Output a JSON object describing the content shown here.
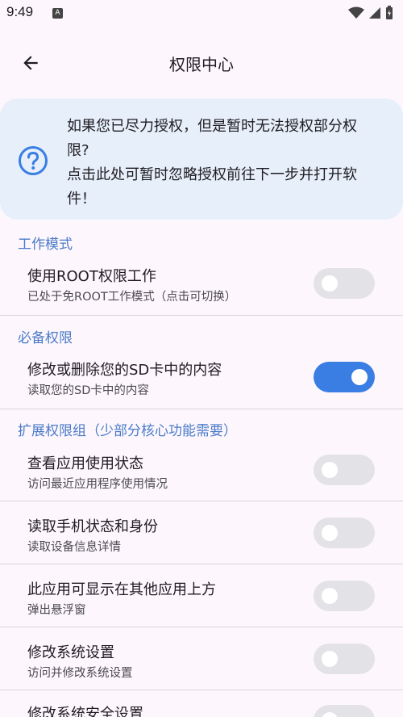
{
  "status_bar": {
    "time": "9:49",
    "app_icon_letter": "A"
  },
  "app_bar": {
    "title": "权限中心"
  },
  "help_card": {
    "lines": [
      "如果您已尽力授权，但是暂时无法授权部分权",
      "限?",
      "点击此处可暂时忽略授权前往下一步并打开软",
      "件！"
    ]
  },
  "sections": [
    {
      "header": "工作模式"
    },
    {
      "header": "必备权限"
    },
    {
      "header": "扩展权限组（少部分核心功能需要）"
    }
  ],
  "rows": [
    {
      "title": "使用ROOT权限工作",
      "subtitle": "已处于免ROOT工作模式（点击可切换）",
      "enabled": false
    },
    {
      "title": "修改或删除您的SD卡中的内容",
      "subtitle": "读取您的SD卡中的内容",
      "enabled": true
    },
    {
      "title": "查看应用使用状态",
      "subtitle": "访问最近应用程序使用情况",
      "enabled": false
    },
    {
      "title": "读取手机状态和身份",
      "subtitle": "读取设备信息详情",
      "enabled": false
    },
    {
      "title": "此应用可显示在其他应用上方",
      "subtitle": "弹出悬浮窗",
      "enabled": false
    },
    {
      "title": "修改系统设置",
      "subtitle": "访问并修改系统设置",
      "enabled": false
    },
    {
      "title": "修改系统安全设置",
      "subtitle": "",
      "enabled": false
    }
  ],
  "colors": {
    "accent": "#4a7bc8",
    "switch_on": "#3a7ee4",
    "switch_off": "#e3e2e7",
    "card_bg": "#e6effa",
    "page_bg": "#fdf7fd"
  }
}
